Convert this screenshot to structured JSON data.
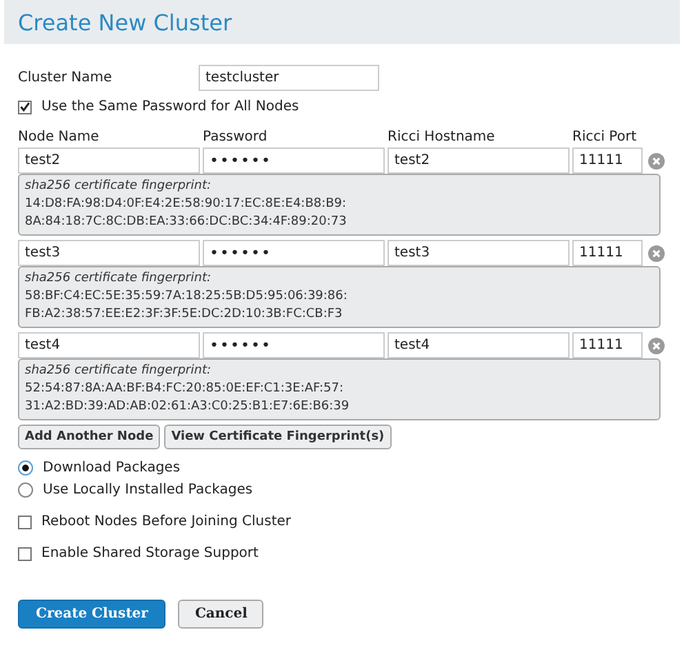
{
  "window": {
    "title": "Create New Cluster"
  },
  "cluster_name": {
    "label": "Cluster Name",
    "value": "testcluster"
  },
  "same_password": {
    "label": "Use the Same Password for All Nodes",
    "checked": true
  },
  "node_columns": [
    "Node Name",
    "Password",
    "Ricci Hostname",
    "Ricci Port"
  ],
  "nodes": [
    {
      "name": "test2",
      "password": "••••••",
      "hostname": "test2",
      "port": "11111",
      "fingerprint_label": "sha256 certificate fingerprint:",
      "fingerprint": [
        "14:D8:FA:98:D4:0F:E4:2E:58:90:17:EC:8E:E4:B8:B9:",
        "8A:84:18:7C:8C:DB:EA:33:66:DC:BC:34:4F:89:20:73"
      ]
    },
    {
      "name": "test3",
      "password": "••••••",
      "hostname": "test3",
      "port": "11111",
      "fingerprint_label": "sha256 certificate fingerprint:",
      "fingerprint": [
        "58:BF:C4:EC:5E:35:59:7A:18:25:5B:D5:95:06:39:86:",
        "FB:A2:38:57:EE:E2:3F:3F:5E:DC:2D:10:3B:FC:CB:F3"
      ]
    },
    {
      "name": "test4",
      "password": "••••••",
      "hostname": "test4",
      "port": "11111",
      "fingerprint_label": "sha256 certificate fingerprint:",
      "fingerprint": [
        "52:54:87:8A:AA:BF:B4:FC:20:85:0E:EF:C1:3E:AF:57:",
        "31:A2:BD:39:AD:AB:02:61:A3:C0:25:B1:E7:6E:B6:39"
      ]
    }
  ],
  "node_buttons": [
    "Add Another Node",
    "View Certificate Fingerprint(s)"
  ],
  "package_options": [
    {
      "label": "Download Packages",
      "selected": true
    },
    {
      "label": "Use Locally Installed Packages",
      "selected": false
    }
  ],
  "options": [
    {
      "label": "Reboot Nodes Before Joining Cluster",
      "checked": false
    },
    {
      "label": "Enable Shared Storage Support",
      "checked": false
    }
  ],
  "actions": [
    {
      "label": "Create Cluster",
      "kind": "primary"
    },
    {
      "label": "Cancel",
      "kind": "secondary"
    }
  ]
}
